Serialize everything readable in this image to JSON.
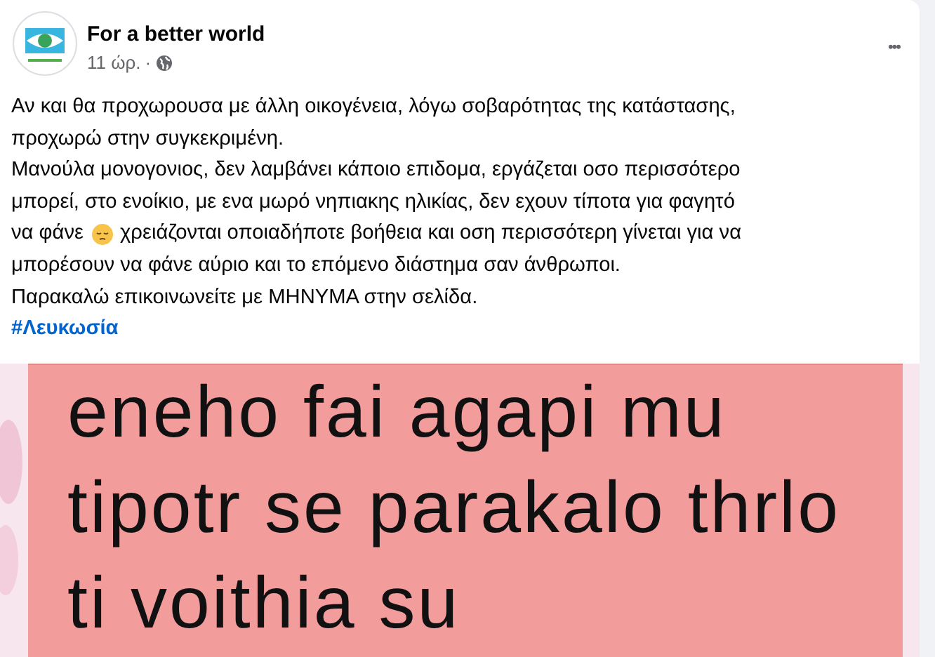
{
  "post": {
    "author": "For a better world",
    "time": "11 ώρ.",
    "separator": "·",
    "more": "•••",
    "paragraphs": [
      {
        "segments": [
          {
            "kind": "text",
            "text": "Αν και θα προχωρουσα με άλλη οικογένεια, λόγω σοβαρότητας της κατάστασης,"
          }
        ]
      },
      {
        "segments": [
          {
            "kind": "text",
            "text": "προχωρώ στην συγκεκριμένη."
          }
        ]
      },
      {
        "segments": [
          {
            "kind": "text",
            "text": "Μανούλα μονογονιος, δεν λαμβάνει κάποιο επιδομα, εργάζεται οσο περισσότερο"
          }
        ]
      },
      {
        "segments": [
          {
            "kind": "text",
            "text": "μπορεί, στο ενοίκιο, με ενα μωρό νηπιακης ηλικίας, δεν εχουν τίποτα για φαγητό"
          }
        ]
      },
      {
        "segments": [
          {
            "kind": "text",
            "text": "να φάνε"
          },
          {
            "kind": "emoji"
          },
          {
            "kind": "text",
            "text": "χρειάζονται οποιαδήποτε βοήθεια και οση περισσότερη γίνεται για να"
          }
        ]
      },
      {
        "segments": [
          {
            "kind": "text",
            "text": "μπορέσουν να φάνε αύριο και το επόμενο διάστημα σαν άνθρωποι."
          }
        ]
      },
      {
        "segments": [
          {
            "kind": "text",
            "text": "Παρακαλώ επικοινωνείτε με ΜΗΝΥΜΑ στην σελίδα."
          }
        ]
      }
    ],
    "hashtag": "#Λευκωσία",
    "image": {
      "kind": "chat-screenshot",
      "message_lines": [
        "eneho fai agapi mu",
        "tipotr se parakalo thrlo",
        "ti voithia su"
      ]
    }
  }
}
